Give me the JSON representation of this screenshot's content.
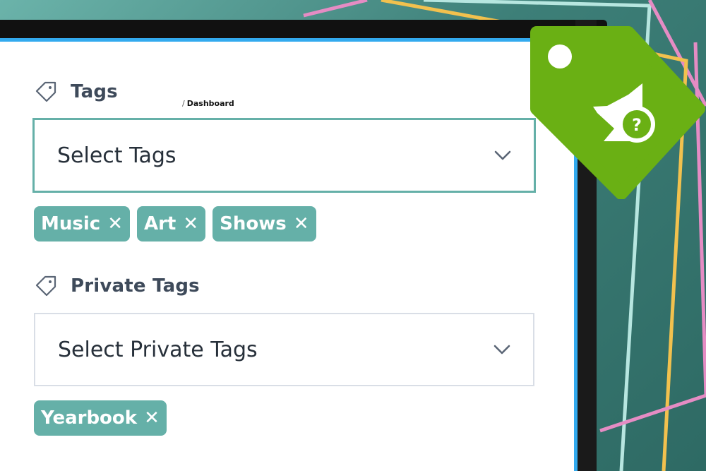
{
  "breadcrumb": {
    "separator": "/",
    "label": "Dashboard"
  },
  "tags": {
    "title": "Tags",
    "select_placeholder": "Select Tags",
    "chips": [
      "Music",
      "Art",
      "Shows"
    ]
  },
  "private_tags": {
    "title": "Private Tags",
    "select_placeholder": "Select Private Tags",
    "chips": [
      "Yearbook"
    ]
  },
  "chip_remove_glyph": "✕",
  "icons": {
    "section": "tag-outline-icon",
    "dropdown": "chevron-down-icon",
    "badge": "tag-question-badge-icon"
  },
  "colors": {
    "accent": "#65b0a8",
    "screen_border": "#33aaee",
    "badge_green": "#6ab014",
    "title_text": "#3e4a5a"
  }
}
